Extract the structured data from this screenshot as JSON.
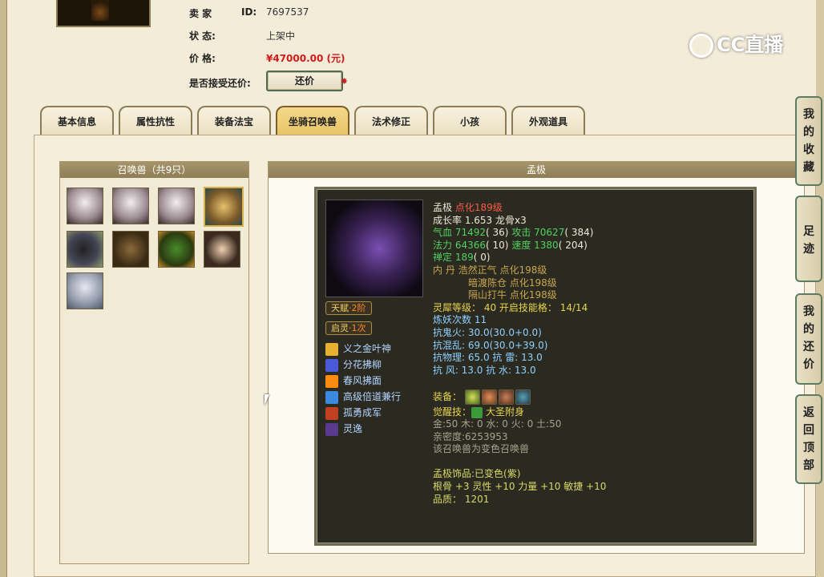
{
  "seller": {
    "label": "卖  家",
    "id_label": "ID:",
    "id": "7697537"
  },
  "status": {
    "label": "状      态:",
    "value": "上架中"
  },
  "price": {
    "label": "价      格:",
    "value": "¥47000.00 (元)"
  },
  "haggle": {
    "label": "是否接受还价:",
    "button": "还价"
  },
  "tabs": [
    {
      "label": "基本信息"
    },
    {
      "label": "属性抗性"
    },
    {
      "label": "装备法宝"
    },
    {
      "label": "坐骑召唤兽"
    },
    {
      "label": "法术修正"
    },
    {
      "label": "小孩"
    },
    {
      "label": "外观道具"
    }
  ],
  "summons": {
    "title": "召唤兽（共9只）",
    "pets": [
      {
        "icon": "pet-portrait-white-fox-1"
      },
      {
        "icon": "pet-portrait-white-fox-2"
      },
      {
        "icon": "pet-portrait-white-fox-3"
      },
      {
        "icon": "pet-portrait-golden-beast"
      },
      {
        "icon": "pet-portrait-ox"
      },
      {
        "icon": "pet-portrait-bull"
      },
      {
        "icon": "pet-portrait-green-ogre"
      },
      {
        "icon": "pet-portrait-girl"
      },
      {
        "icon": "pet-portrait-white-sage"
      }
    ]
  },
  "detail": {
    "header": "孟极",
    "name": "孟极",
    "rebirth": "点化189级",
    "growth": "成长率 1.653 龙骨x3",
    "hp_label": "气血",
    "hp": "71492",
    "hp_add": "( 36)",
    "atk_label": "攻击",
    "atk": "70627",
    "atk_add": "( 384)",
    "mp_label": "法力",
    "mp": "64366",
    "mp_add": "( 10)",
    "spd_label": "速度",
    "spd": "1380",
    "spd_add": "( 204)",
    "zen_label": "禅定",
    "zen": "189",
    "zen_add": "( 0)",
    "inner_label": "内    丹",
    "inner": [
      "浩然正气 点化198级",
      "暗渡陈仓 点化198级",
      "隔山打牛 点化198级"
    ],
    "spirit": "灵犀等级： 40  开启技能格： 14/14",
    "refine": "炼妖次数 11",
    "resists": [
      "抗鬼火: 30.0(30.0+0.0)",
      "抗混乱: 69.0(30.0+39.0)",
      "抗物理: 65.0  抗     雷: 13.0",
      "抗    风: 13.0  抗     水: 13.0"
    ],
    "equip_label": "装备：",
    "equip_icons": [
      "equip-ring-icon",
      "equip-armor-icon",
      "equip-collar-icon",
      "equip-blade-icon"
    ],
    "awaken_label": "觉醒技：",
    "awaken": "大圣附身",
    "elements": "金:50  木: 0  水: 0  火: 0  土:50",
    "intimacy": "亲密度:6253953",
    "variant": "该召唤兽为变色召唤兽",
    "ornament": "孟极饰品:已变色(紫)",
    "bonus": "根骨 +3 灵性 +10 力量 +10 敏捷 +10",
    "quality": "品质： 1201",
    "talent_tag": {
      "label": "天赋",
      "rank": "·2阶"
    },
    "spirit_tag": {
      "label": "启灵",
      "rank": "·1次"
    },
    "skills": [
      {
        "name": "义之金叶神",
        "icon": "gold-leaf-skill-icon",
        "color": "#e8b030"
      },
      {
        "name": "分花拂柳",
        "icon": "flower-skill-icon",
        "color": "#4a5ad8"
      },
      {
        "name": "春风拂面",
        "icon": "fire-skill-icon",
        "color": "#ff8a10"
      },
      {
        "name": "高级倍道兼行",
        "icon": "wing-skill-icon",
        "color": "#3a8ae0"
      },
      {
        "name": "孤勇成军",
        "icon": "army-skill-icon",
        "color": "#c04020"
      },
      {
        "name": "灵逸",
        "icon": "spirit-skill-icon",
        "color": "#5a3a90"
      }
    ]
  },
  "side": {
    "fav": "我的收藏",
    "trail": "足迹",
    "haggles": "我的还价",
    "top": "返回顶部"
  },
  "watermark": "CC直播"
}
